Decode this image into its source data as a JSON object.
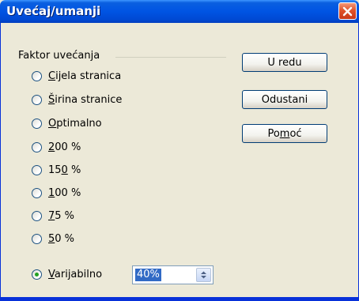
{
  "window": {
    "title": "Uvećaj/umanji"
  },
  "zoom_group": {
    "label": "Faktor uvećanja",
    "options": [
      {
        "label": "Cijela stranica",
        "access_key_index": 0,
        "checked": false
      },
      {
        "label": "Širina stranice",
        "access_key_index": 0,
        "checked": false
      },
      {
        "label": "Optimalno",
        "access_key_index": 0,
        "checked": false
      },
      {
        "label": "200 %",
        "access_key_index": 0,
        "checked": false
      },
      {
        "label": "150 %",
        "access_key_index": 2,
        "checked": false
      },
      {
        "label": "100 %",
        "access_key_index": 0,
        "checked": false
      },
      {
        "label": "75 %",
        "access_key_index": 0,
        "checked": false
      },
      {
        "label": "50 %",
        "access_key_index": 0,
        "checked": false
      },
      {
        "label": "Varijabilno",
        "access_key_index": 0,
        "checked": true
      }
    ],
    "variable_value": "40%"
  },
  "buttons": {
    "ok": "U redu",
    "cancel": "Odustani",
    "help": "Pomoć"
  },
  "colors": {
    "titlebar": "#0054e3",
    "close_button": "#e0532b",
    "selection": "#316ac5",
    "radio_dot": "#21a121"
  }
}
